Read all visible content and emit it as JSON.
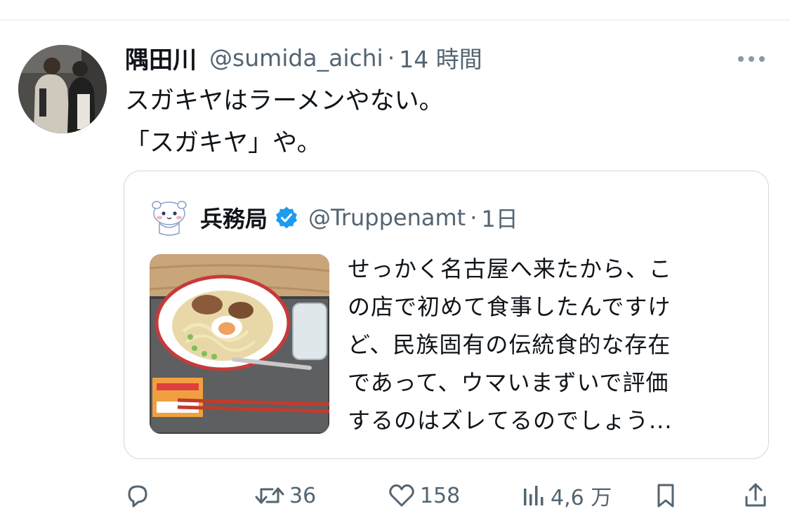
{
  "tweet": {
    "display_name": "隅田川",
    "handle": "@sumida_aichi",
    "separator": "·",
    "time": "14 時間",
    "text_lines": [
      "スガキヤはラーメンやない。",
      "「スガキヤ」や。"
    ]
  },
  "quote": {
    "display_name": "兵務局",
    "handle": "@Truppenamt",
    "separator": "·",
    "time": "1日",
    "text_lines": [
      "せっかく名古屋へ来たから、こ",
      "の店で初めて食事したんですけ",
      "ど、民族固有の伝統食的な存在",
      "であって、ウマいまずいで評価",
      "するのはズレてるのでしょう..."
    ],
    "media_icon": "ramen-photo"
  },
  "actions": {
    "reply": {
      "icon": "reply-icon",
      "count": ""
    },
    "retweet": {
      "icon": "retweet-icon",
      "count": "36"
    },
    "like": {
      "icon": "heart-icon",
      "count": "158"
    },
    "views": {
      "icon": "views-icon",
      "count": "4,6 万"
    },
    "bookmark": {
      "icon": "bookmark-icon"
    },
    "share": {
      "icon": "share-icon"
    }
  },
  "colors": {
    "text": "#0f1419",
    "secondary": "#536471",
    "border": "#cfd9de",
    "verified": "#1d9bf0"
  }
}
